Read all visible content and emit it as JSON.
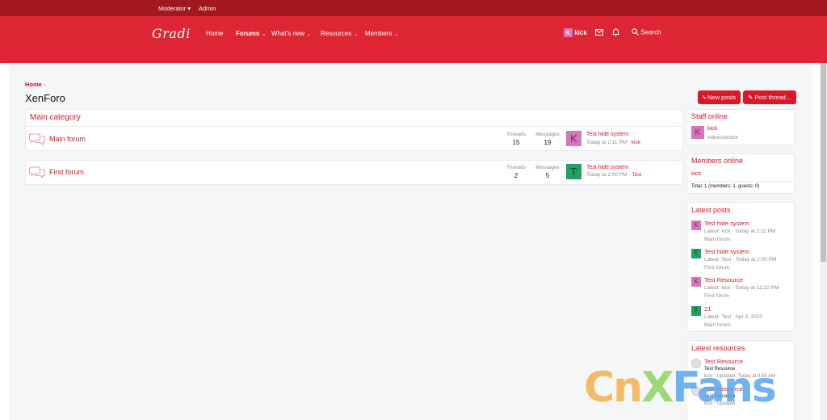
{
  "staffbar": {
    "moderator": "Moderator ▾",
    "admin": "Admin"
  },
  "header": {
    "logo": "Gradi",
    "nav": [
      {
        "label": "Home",
        "chevron": ""
      },
      {
        "label": "Forums",
        "chevron": "⌄"
      },
      {
        "label": "What's new",
        "chevron": "⌄"
      },
      {
        "label": "Resources",
        "chevron": "⌄"
      },
      {
        "label": "Members",
        "chevron": "⌄"
      }
    ],
    "user": {
      "initial": "K",
      "name": "kick"
    },
    "search": "Search"
  },
  "breadcrumb": "Home",
  "page_title": "XenForo",
  "buttons": {
    "new_posts": "New posts",
    "post_thread": "Post thread…"
  },
  "category": {
    "title": "Main category",
    "forums": [
      {
        "name": "Main forum",
        "threads_label": "Threads",
        "threads": "15",
        "messages_label": "Messages",
        "messages": "19",
        "avatar": "K",
        "avatar_color": "#d577b8",
        "last_title": "Test hide system",
        "last_time": "Today at 2:11 PM",
        "last_user": "kick"
      }
    ]
  },
  "forum2": {
    "name": "First forum",
    "threads_label": "Threads",
    "threads": "2",
    "messages_label": "Messages",
    "messages": "5",
    "avatar": "T",
    "avatar_color": "#21a062",
    "last_title": "Test hide system",
    "last_time": "Today at 2:00 PM",
    "last_user": "Test"
  },
  "staff_online": {
    "title": "Staff online",
    "avatar": "K",
    "name": "kick",
    "role": "Administrator"
  },
  "members_online": {
    "title": "Members online",
    "member": "kick",
    "total": "Total: 1 (members: 1, guests: 0)"
  },
  "latest_posts": {
    "title": "Latest posts",
    "items": [
      {
        "avatar": "K",
        "color": "#d577b8",
        "title": "Test hide system",
        "meta": "Latest: kick · Today at 2:11 PM",
        "forum": "Main forum"
      },
      {
        "avatar": "T",
        "color": "#21a062",
        "title": "Test hide system",
        "meta": "Latest: Test · Today at 2:00 PM",
        "forum": "First forum"
      },
      {
        "avatar": "K",
        "color": "#d577b8",
        "title": "Test Resource",
        "meta": "Latest: kick · Today at 12:22 PM",
        "forum": "First forum"
      },
      {
        "avatar": "T",
        "color": "#21a062",
        "title": "21",
        "meta": "Latest: Test · Apr 2, 2020",
        "forum": "Main forum"
      }
    ]
  },
  "latest_resources": {
    "title": "Latest resources",
    "items": [
      {
        "title": "Test Resource",
        "tag": "Test Resource",
        "meta": "kick · Updated: Today at 9:56 AM"
      },
      {
        "title": "Test Resource",
        "tag": "Test Resource",
        "meta": "kick · Updated"
      }
    ]
  },
  "watermark": {
    "cn": "Cn",
    "x": "X",
    "fans": "Fans"
  }
}
